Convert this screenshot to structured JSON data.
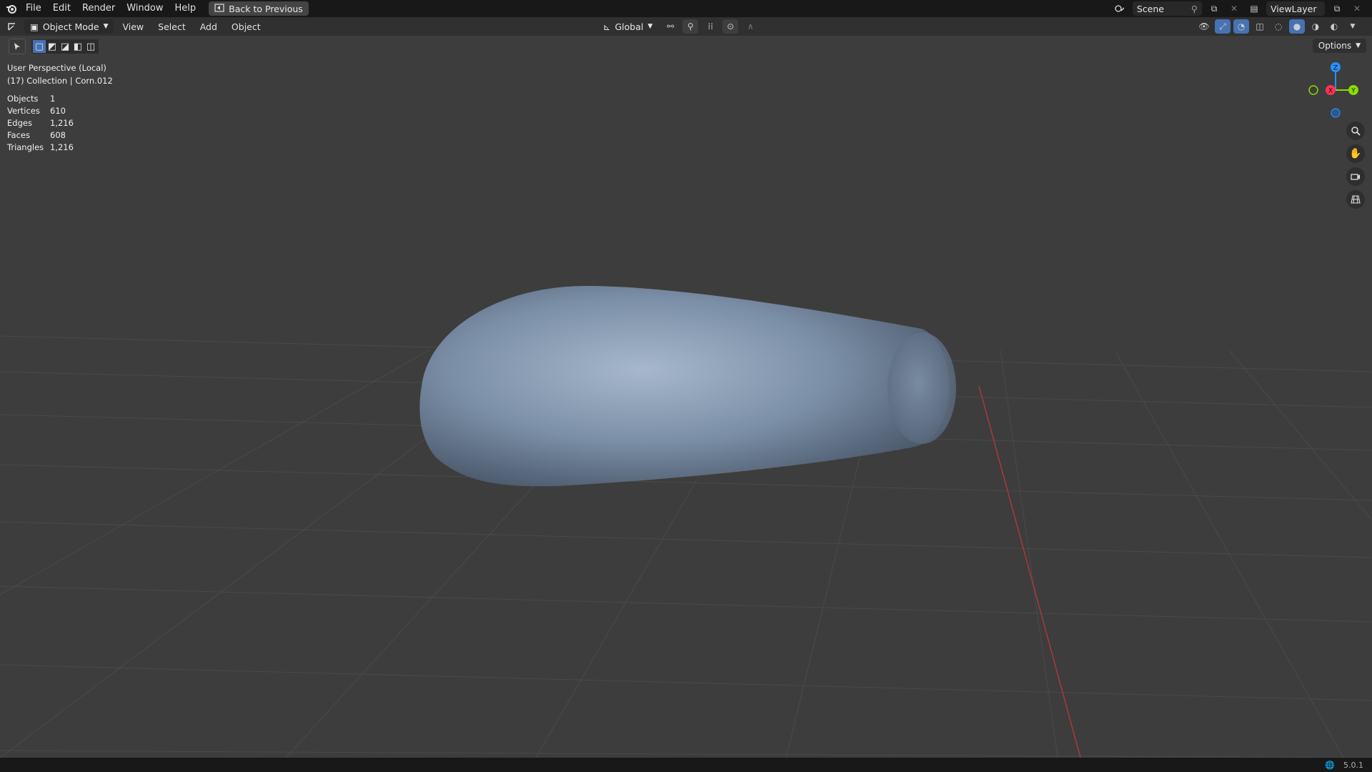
{
  "menu": {
    "items": [
      "File",
      "Edit",
      "Render",
      "Window",
      "Help"
    ],
    "back_label": "Back to Previous"
  },
  "topright": {
    "scene": "Scene",
    "view_layer": "ViewLayer"
  },
  "header": {
    "mode": "Object Mode",
    "menus": [
      "View",
      "Select",
      "Add",
      "Object"
    ],
    "orientation": "Global"
  },
  "toolbar": {
    "options_label": "Options"
  },
  "overlay": {
    "perspective": "User Perspective (Local)",
    "collection": "(17) Collection | Corn.012"
  },
  "stats": [
    {
      "label": "Objects",
      "value": "1"
    },
    {
      "label": "Vertices",
      "value": "610"
    },
    {
      "label": "Edges",
      "value": "1,216"
    },
    {
      "label": "Faces",
      "value": "608"
    },
    {
      "label": "Triangles",
      "value": "1,216"
    }
  ],
  "gizmo": {
    "z_label": "Z",
    "x_label": "X",
    "y_label": "Y"
  },
  "status": {
    "version": "5.0.1"
  },
  "colors": {
    "background": "#3d3d3d",
    "object": "#7a8ea6",
    "axis_x": "#ff3352",
    "axis_y": "#8bdc00",
    "axis_z": "#2890ff"
  }
}
